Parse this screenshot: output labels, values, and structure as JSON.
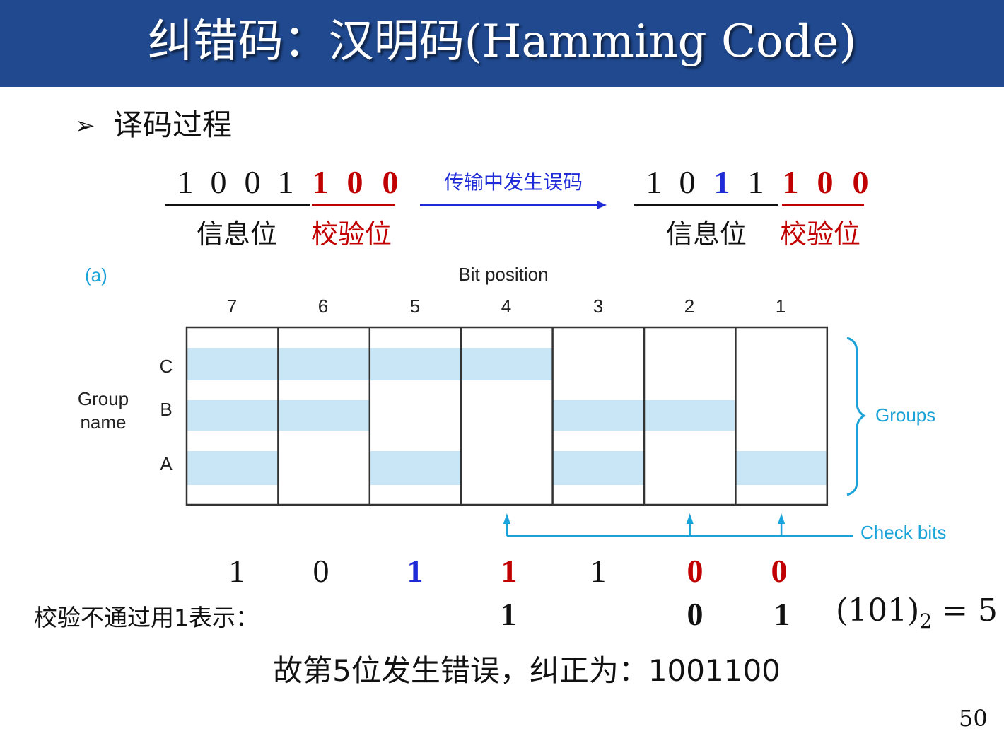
{
  "title": "纠错码：汉明码(Hamming Code)",
  "section": {
    "bullet_icon": "arrow-bullet-icon",
    "heading": "译码过程"
  },
  "sent_code": {
    "info_bits": [
      "1",
      "0",
      "0",
      "1"
    ],
    "check_bits": [
      "1",
      "0",
      "0"
    ],
    "info_label": "信息位",
    "check_label": "校验位"
  },
  "transmission": {
    "label": "传输中发生误码"
  },
  "received_code": {
    "info_bits": [
      "1",
      "0",
      "1",
      "1"
    ],
    "check_bits": [
      "1",
      "0",
      "0"
    ],
    "info_label": "信息位",
    "check_label": "校验位"
  },
  "diagram": {
    "panel_label": "(a)",
    "bit_position_label": "Bit position",
    "positions": [
      "7",
      "6",
      "5",
      "4",
      "3",
      "2",
      "1"
    ],
    "group_name_label": [
      "Group",
      "name"
    ],
    "groups": [
      {
        "name": "C",
        "covers": [
          "7",
          "6",
          "5",
          "4"
        ]
      },
      {
        "name": "B",
        "covers": [
          "7",
          "6",
          "3",
          "2"
        ]
      },
      {
        "name": "A",
        "covers": [
          "7",
          "5",
          "3",
          "1"
        ]
      }
    ],
    "groups_label": "Groups",
    "check_bits_label": "Check bits",
    "check_bit_positions": [
      "4",
      "2",
      "1"
    ],
    "colors": {
      "band": "#c9e6f7",
      "accent": "#1aa3d9"
    }
  },
  "received_row": {
    "bits": [
      "1",
      "0",
      "1",
      "1",
      "1",
      "0",
      "0"
    ],
    "styles": [
      "plain",
      "plain",
      "blue",
      "red",
      "plain",
      "red",
      "red"
    ]
  },
  "check_results": {
    "label": "校验不通过用1表示：",
    "values": [
      "1",
      "0",
      "1"
    ]
  },
  "syndrome": {
    "base": "(101)",
    "subscript": "2",
    "rest": " = 5"
  },
  "conclusion": "故第5位发生错误，纠正为：1001100",
  "page_number": "50",
  "colors": {
    "title_bar": "#20498f",
    "red": "#c00000",
    "blue": "#1f2bd6"
  }
}
